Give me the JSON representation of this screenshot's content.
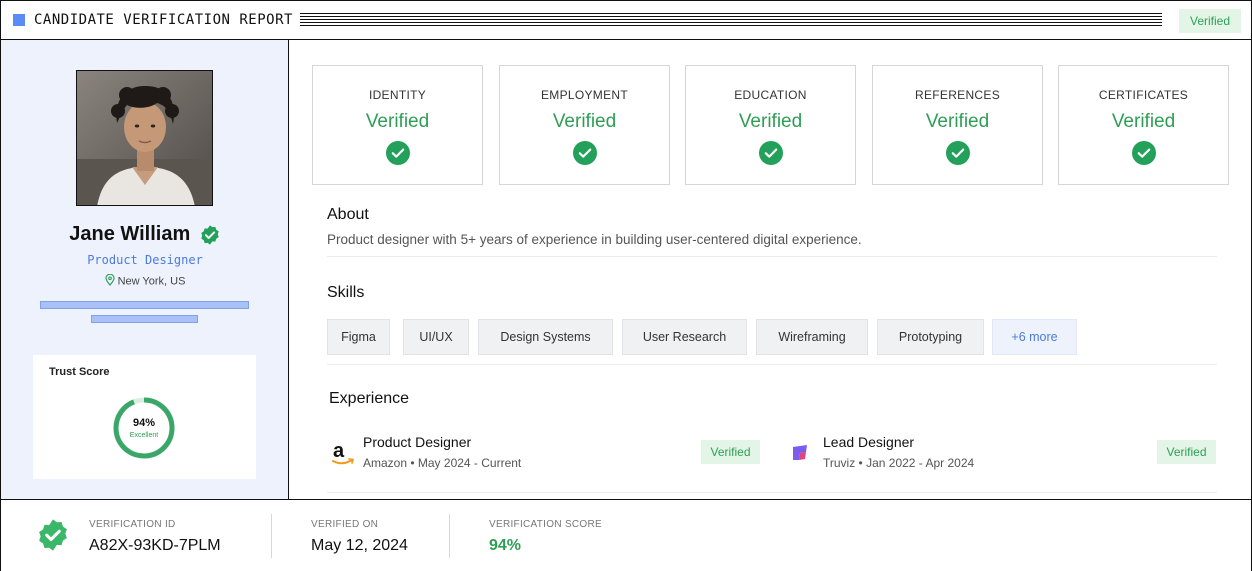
{
  "header": {
    "title": "CANDIDATE VERIFICATION REPORT",
    "status_badge": "Verified"
  },
  "profile": {
    "name": "Jane William",
    "role": "Product Designer",
    "location": "New York, US",
    "avatar_icon": "profile-photo"
  },
  "trust": {
    "label": "Trust Score",
    "percent_text": "94%",
    "rating": "Excellent",
    "score_value": 94
  },
  "checks": [
    {
      "label": "IDENTITY",
      "status": "Verified"
    },
    {
      "label": "EMPLOYMENT",
      "status": "Verified"
    },
    {
      "label": "EDUCATION",
      "status": "Verified"
    },
    {
      "label": "REFERENCES",
      "status": "Verified"
    },
    {
      "label": "CERTIFICATES",
      "status": "Verified"
    }
  ],
  "about": {
    "title": "About",
    "text": "Product designer with 5+ years of experience in building user-centered digital experience."
  },
  "skills": {
    "title": "Skills",
    "items": [
      "Figma",
      "UI/UX",
      "Design Systems",
      "User Research",
      "Wireframing",
      "Prototyping"
    ],
    "more": "+6 more"
  },
  "experience": {
    "title": "Experience",
    "jobs": [
      {
        "title": "Product Designer",
        "subtitle": "Amazon • May 2024 - Current",
        "badge": "Verified",
        "logo": "amazon-logo"
      },
      {
        "title": "Lead Designer",
        "subtitle": "Truviz • Jan 2022 - Apr 2024",
        "badge": "Verified",
        "logo": "truviz-logo"
      }
    ]
  },
  "footer": {
    "verification_id_label": "VERIFICATION ID",
    "verification_id": "A82X-93KD-7PLM",
    "verified_on_label": "VERIFIED ON",
    "verified_on": "May 12, 2024",
    "score_label": "VERIFICATION SCORE",
    "score": "94%"
  },
  "colors": {
    "accent_green": "#2f9e55",
    "accent_blue": "#4b7bdc",
    "panel_bg": "#eef2fd"
  }
}
